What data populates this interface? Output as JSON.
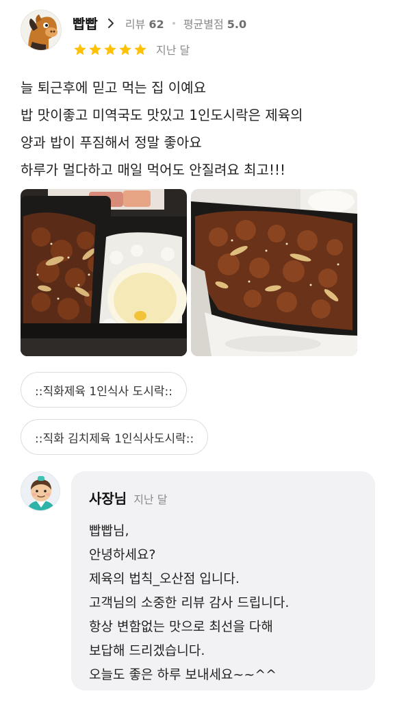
{
  "review": {
    "username": "빱빱",
    "review_label": "리뷰",
    "review_count": "62",
    "avg_label": "평균별점",
    "avg_rating": "5.0",
    "star_rating": 5,
    "time": "지난 달",
    "lines": [
      "늘 퇴근후에 믿고 먹는 집 이예요",
      "밥 맛이좋고 미역국도 맛있고 1인도시락은 제육의",
      "양과 밥이 푸짐해서 정말 좋아요",
      "하루가 멀다하고 매일 먹어도 안질려요 최고!!!"
    ]
  },
  "photos": [
    {
      "alt": "pork bulgogi with rice and fried egg"
    },
    {
      "alt": "pork bulgogi in tray"
    }
  ],
  "menu_tags": [
    "::직화제육 1인식사 도시락::",
    "::직화 김치제육 1인식사도시락::"
  ],
  "reply": {
    "name": "사장님",
    "time": "지난 달",
    "lines": [
      "빱빱님,",
      "안녕하세요?",
      "제육의 법칙_오산점 입니다.",
      "고객님의 소중한 리뷰 감사 드립니다.",
      "항상 변함없는 맛으로 최선을 다해",
      "보답해 드리겠습니다.",
      "오늘도 좋은 하루 보내세요~~^^"
    ]
  },
  "colors": {
    "star": "#ffc107",
    "reply_bg": "#f2f2f4",
    "tag_border": "#dcdcdc"
  }
}
